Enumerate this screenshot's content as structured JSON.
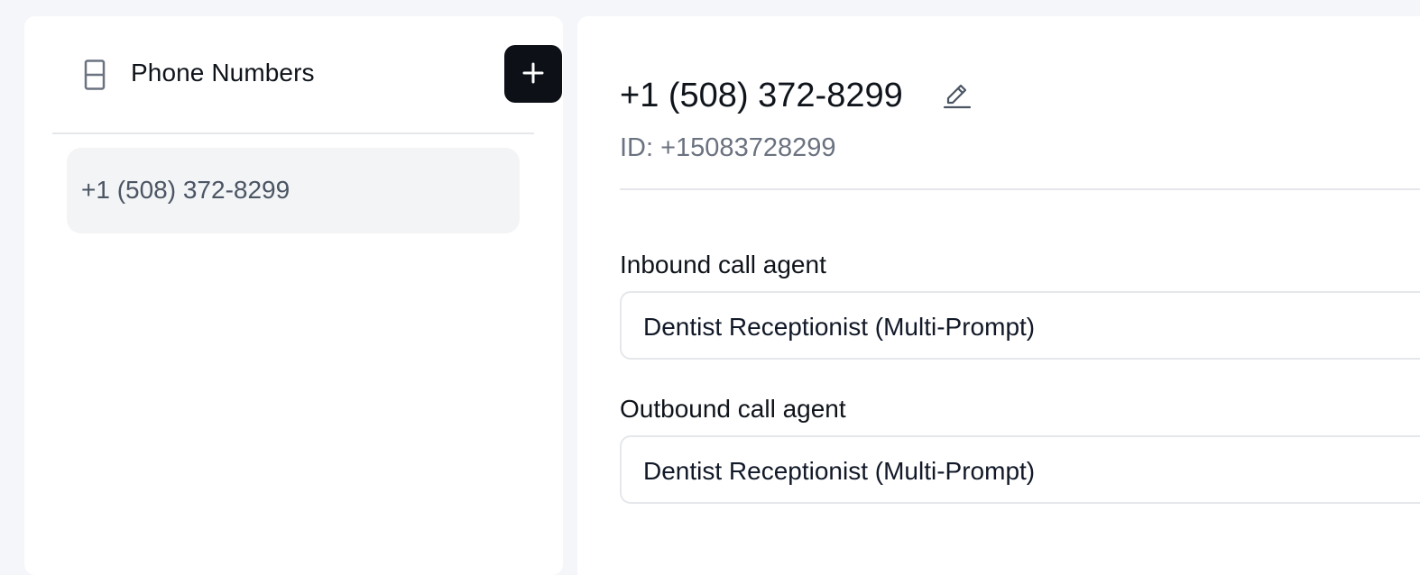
{
  "sidebar": {
    "title": "Phone Numbers",
    "add_button_icon": "plus-icon",
    "header_icon": "phone-icon",
    "items": [
      {
        "label": "+1 (508) 372-8299"
      }
    ]
  },
  "detail": {
    "number": "+1 (508) 372-8299",
    "edit_icon": "pencil-icon",
    "id_text": "ID: +15083728299",
    "inbound": {
      "label": "Inbound call agent",
      "value": "Dentist Receptionist (Multi-Prompt)"
    },
    "outbound": {
      "label": "Outbound call agent",
      "value": "Dentist Receptionist (Multi-Prompt)"
    }
  },
  "colors": {
    "background": "#f4f6f9",
    "panel": "#ffffff",
    "primary_button": "#0d1117",
    "selected_item": "#f3f4f6",
    "text_primary": "#0f141b",
    "text_muted": "#6b7280",
    "border": "#e5e7eb"
  }
}
